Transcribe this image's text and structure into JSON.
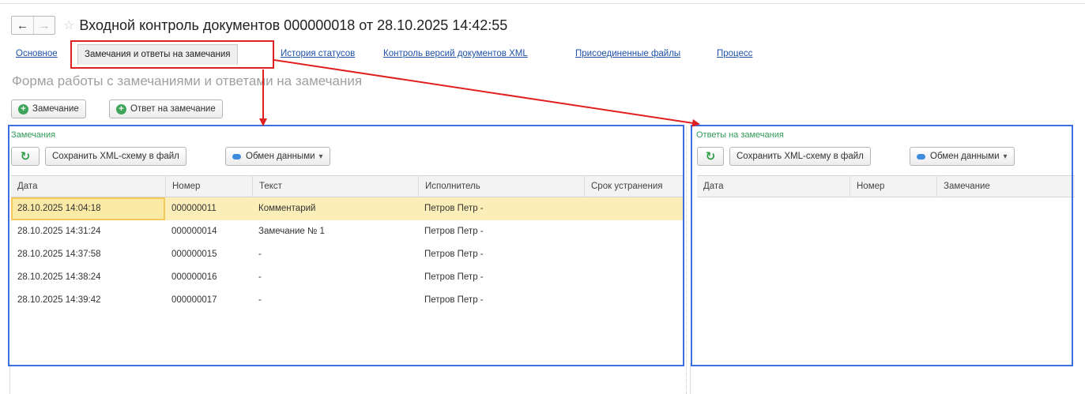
{
  "window": {
    "title": "Входной контроль документов 000000018 от 28.10.2025 14:42:55",
    "back_glyph": "←",
    "forward_glyph": "→",
    "star_glyph": "☆"
  },
  "tabs": [
    {
      "label": "Основное",
      "active": false
    },
    {
      "label": "Замечания и ответы на замечания",
      "active": true
    },
    {
      "label": "История статусов",
      "active": false
    },
    {
      "label": "Контроль версий документов XML",
      "active": false
    },
    {
      "label": "Присоединенные файлы",
      "active": false
    },
    {
      "label": "Процесс",
      "active": false
    }
  ],
  "form": {
    "subtitle": "Форма работы с замечаниями и ответами на замечания",
    "add_remark_label": "Замечание",
    "add_answer_label": "Ответ на замечание"
  },
  "remarks": {
    "section_label": "Замечания",
    "save_xml_label": "Сохранить XML-схему в файл",
    "exchange_label": "Обмен данными",
    "columns": [
      "Дата",
      "Номер",
      "Текст",
      "Исполнитель",
      "Срок устранения"
    ],
    "rows": [
      [
        "28.10.2025 14:04:18",
        "000000011",
        "Комментарий",
        "Петров Петр -",
        ""
      ],
      [
        "28.10.2025 14:31:24",
        "000000014",
        "Замечание № 1",
        "Петров Петр -",
        ""
      ],
      [
        "28.10.2025 14:37:58",
        "000000015",
        "-",
        "Петров Петр -",
        ""
      ],
      [
        "28.10.2025 14:38:24",
        "000000016",
        "-",
        "Петров Петр -",
        ""
      ],
      [
        "28.10.2025 14:39:42",
        "000000017",
        "-",
        "Петров Петр -",
        ""
      ]
    ]
  },
  "answers": {
    "section_label": "Ответы на замечания",
    "save_xml_label": "Сохранить XML-схему в файл",
    "exchange_label": "Обмен данными",
    "columns": [
      "Дата",
      "Номер",
      "Замечание"
    ],
    "rows": []
  },
  "colors": {
    "link": "#1f52a8",
    "selected_row": "#fbeeb8",
    "highlight_red": "#e02020",
    "highlight_blue": "#3c6fe0",
    "section_green": "#2f9a5a"
  }
}
